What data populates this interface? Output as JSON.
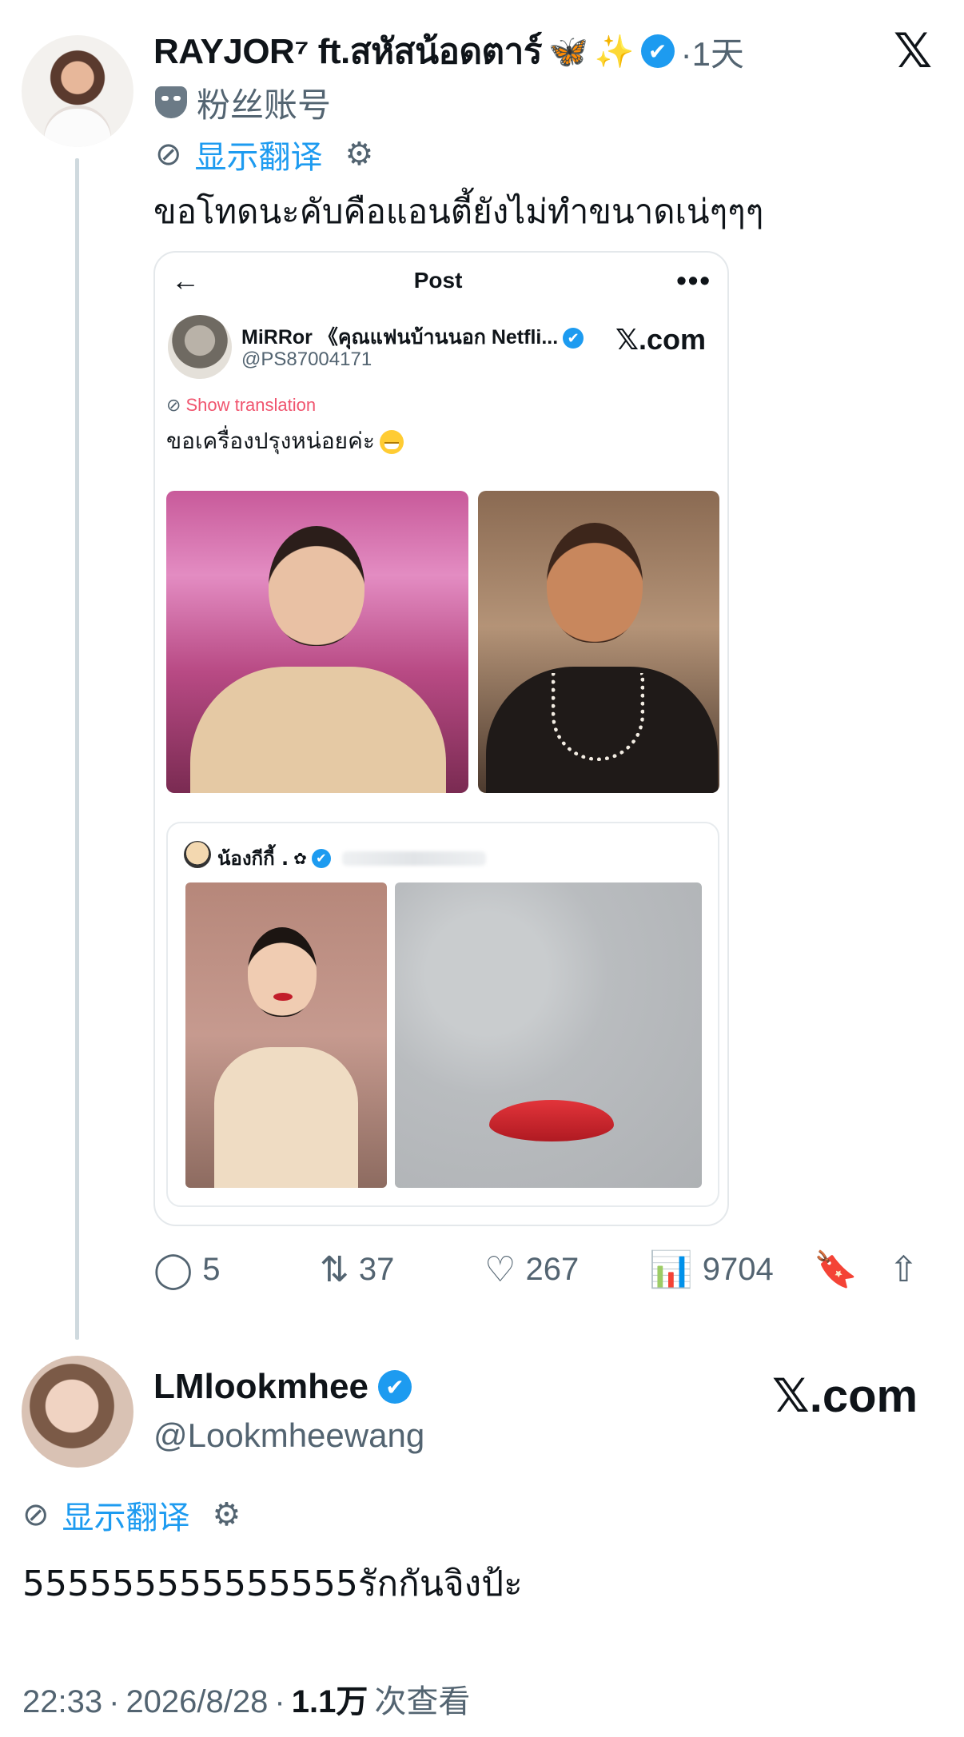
{
  "tweet1": {
    "name": "RAYJOR⁷ ft.สหัสน้อดตาร์",
    "butterfly_emoji": "🦋",
    "sparkle_emoji": "✨",
    "verified_icon": "✔",
    "time": "·1天",
    "fan_label": "粉丝账号",
    "translate_label": "显示翻译",
    "text": "ขอโทดนะคับคือแอนตี้ยังไม่ทำขนาดเน่ๆๆๆ"
  },
  "embedded": {
    "back_icon": "←",
    "title": "Post",
    "more_icon": "•••",
    "name": "MiRRor 《คุณแฟนบ้านนอก Netfli...",
    "handle": "@PS87004171",
    "xcom": "𝕏.com",
    "show_translation": "Show translation",
    "text": "ขอเครื่องปรุงหน่อยค่ะ",
    "quote": {
      "name": "น้องกีกี้ .",
      "flower": "✿"
    }
  },
  "actions": {
    "replies": "5",
    "retweets": "37",
    "likes": "267",
    "views": "9704"
  },
  "tweet2": {
    "name": "LMlookmhee",
    "handle": "@Lookmheewang",
    "xcom": "𝕏.com",
    "translate_label": "显示翻译",
    "text": "555555555555555รักกันจิงป้ะ"
  },
  "meta": {
    "time": "22:33",
    "date": "2026/8/28",
    "views_count": "1.1万",
    "views_label": "次查看"
  },
  "icons": {
    "x_logo": "𝕏",
    "translate": "⊘",
    "gear": "⚙",
    "reply": "◯",
    "retweet": "⇅",
    "like": "♡",
    "views": "📊",
    "bookmark": "🔖",
    "share": "⇧"
  },
  "colors": {
    "accent": "#1d9bf0",
    "secondary_text": "#536471",
    "text": "#0f1419",
    "translation_pink": "#f0556f"
  }
}
